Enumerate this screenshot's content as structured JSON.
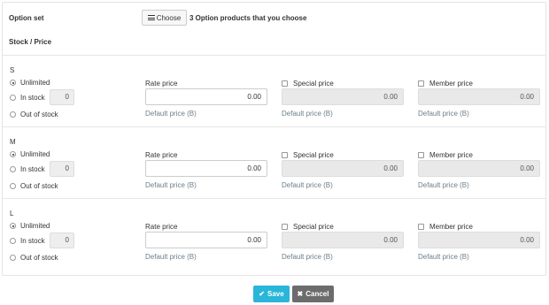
{
  "header": {
    "option_set_label": "Option set",
    "choose_label": "Choose",
    "chosen_text": "3 Option products that you choose",
    "stock_price_label": "Stock / Price"
  },
  "icons": {
    "choose": "list-icon",
    "save": "check-icon",
    "cancel": "close-icon"
  },
  "colors": {
    "save_button": "#29b6d8",
    "cancel_button": "#6c6c6c",
    "default_price_text": "#6b7f8c"
  },
  "options": [
    {
      "size": "S",
      "stock": {
        "unlimited": "Unlimited",
        "in_stock": "In stock",
        "qty": "0",
        "out_of_stock": "Out of stock",
        "selected": "unlimited"
      },
      "rate": {
        "label": "Rate price",
        "value": "0.00",
        "default": "Default price (B)"
      },
      "special": {
        "label": "Special price",
        "value": "0.00",
        "default": "Default price (B)",
        "checked": false
      },
      "member": {
        "label": "Member price",
        "value": "0.00",
        "default": "Default price (B)",
        "checked": false
      }
    },
    {
      "size": "M",
      "stock": {
        "unlimited": "Unlimited",
        "in_stock": "In stock",
        "qty": "0",
        "out_of_stock": "Out of stock",
        "selected": "unlimited"
      },
      "rate": {
        "label": "Rate price",
        "value": "0.00",
        "default": "Default price (B)"
      },
      "special": {
        "label": "Special price",
        "value": "0.00",
        "default": "Default price (B)",
        "checked": false
      },
      "member": {
        "label": "Member price",
        "value": "0.00",
        "default": "Default price (B)",
        "checked": false
      }
    },
    {
      "size": "L",
      "stock": {
        "unlimited": "Unlimited",
        "in_stock": "In stock",
        "qty": "0",
        "out_of_stock": "Out of stock",
        "selected": "unlimited"
      },
      "rate": {
        "label": "Rate price",
        "value": "0.00",
        "default": "Default price (B)"
      },
      "special": {
        "label": "Special price",
        "value": "0.00",
        "default": "Default price (B)",
        "checked": false
      },
      "member": {
        "label": "Member price",
        "value": "0.00",
        "default": "Default price (B)",
        "checked": false
      }
    }
  ],
  "footer": {
    "save_label": "Save",
    "cancel_label": "Cancel"
  }
}
